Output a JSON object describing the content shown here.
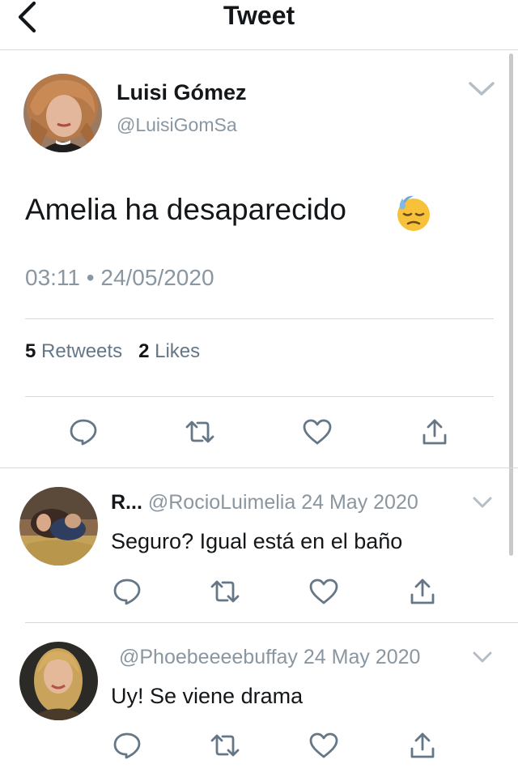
{
  "header": {
    "title": "Tweet"
  },
  "tweet": {
    "author_name": "Luisi Gómez",
    "author_handle": "@LuisiGomSa",
    "text": "Amelia ha desaparecido",
    "emoji": "downcast-face-with-sweat",
    "time": "03:11",
    "separator": "•",
    "date": "24/05/2020",
    "retweets_count": "5",
    "retweets_label": "Retweets",
    "likes_count": "2",
    "likes_label": "Likes"
  },
  "icons": {
    "reply": "reply-icon",
    "retweet": "retweet-icon",
    "like": "heart-icon",
    "share": "share-icon",
    "caret": "chevron-down-icon",
    "back": "back-icon"
  },
  "colors": {
    "icon": "#657786",
    "text": "#14171a",
    "muted": "#8a96a0",
    "divider": "#d6d9db"
  },
  "replies": [
    {
      "name": "R...",
      "handle": "@RocioLuimelia",
      "date": "24 May 2020",
      "text": "Seguro? Igual está en el baño"
    },
    {
      "name": "",
      "handle": "@Phoebeeeebuffay",
      "date": "24 May 2020",
      "text": "Uy! Se viene drama"
    }
  ]
}
